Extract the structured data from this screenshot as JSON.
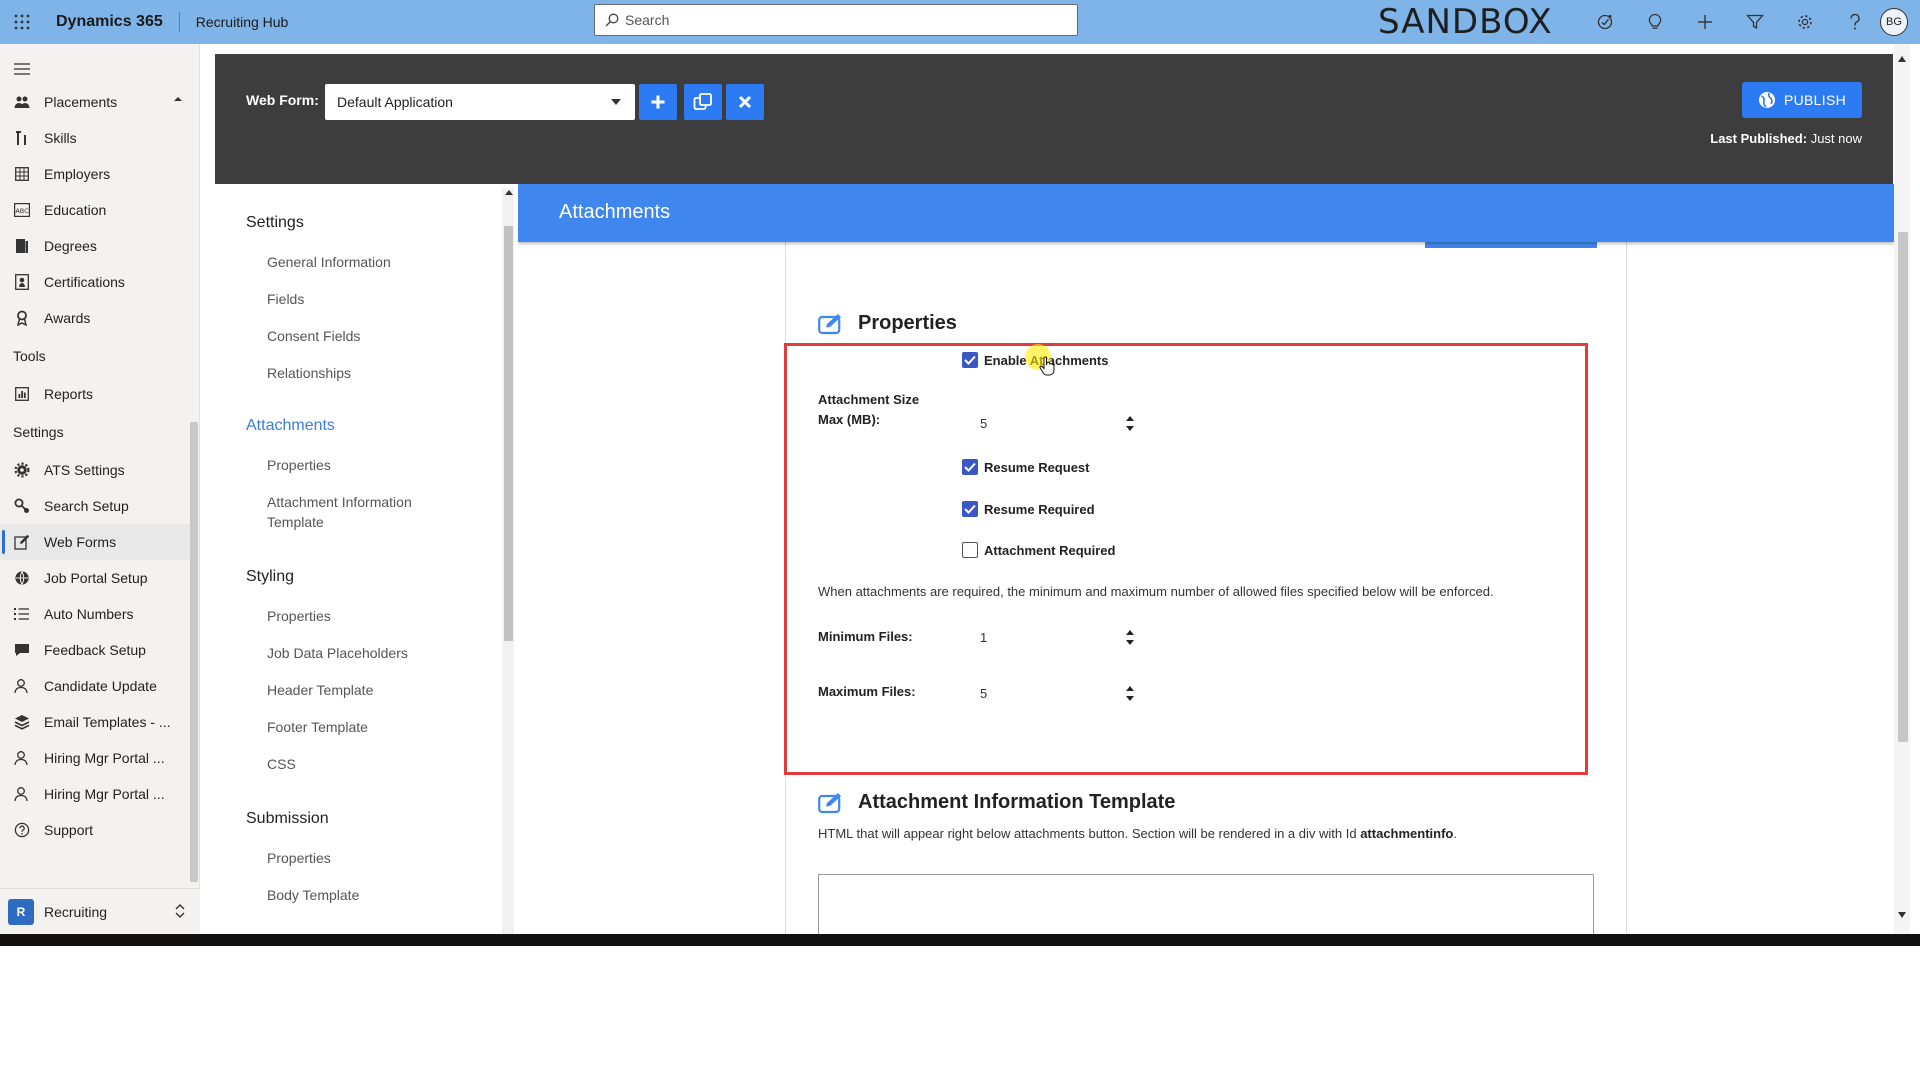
{
  "topbar": {
    "app_name": "Dynamics 365",
    "hub_name": "Recruiting Hub",
    "search_placeholder": "Search",
    "environment_label": "SANDBOX",
    "avatar_initials": "BG",
    "icons": [
      "assistant-icon",
      "lightbulb-icon",
      "plus-icon",
      "filter-icon",
      "gear-icon",
      "help-icon"
    ]
  },
  "leftnav": {
    "items_top": [
      {
        "label": "Placements",
        "icon": "people-icon"
      },
      {
        "label": "Skills",
        "icon": "skills-icon"
      },
      {
        "label": "Employers",
        "icon": "grid-icon"
      },
      {
        "label": "Education",
        "icon": "abc-icon"
      },
      {
        "label": "Degrees",
        "icon": "book-icon"
      },
      {
        "label": "Certifications",
        "icon": "certificate-icon"
      },
      {
        "label": "Awards",
        "icon": "award-icon"
      }
    ],
    "group_tools": "Tools",
    "items_tools": [
      {
        "label": "Reports",
        "icon": "report-icon"
      }
    ],
    "group_settings": "Settings",
    "items_settings": [
      {
        "label": "ATS Settings",
        "icon": "gear-icon"
      },
      {
        "label": "Search Setup",
        "icon": "search-setup-icon"
      },
      {
        "label": "Web Forms",
        "icon": "edit-icon"
      },
      {
        "label": "Job Portal Setup",
        "icon": "globe-icon"
      },
      {
        "label": "Auto Numbers",
        "icon": "list-icon"
      },
      {
        "label": "Feedback Setup",
        "icon": "feedback-icon"
      },
      {
        "label": "Candidate Update",
        "icon": "person-icon"
      },
      {
        "label": "Email Templates - ...",
        "icon": "layers-icon"
      },
      {
        "label": "Hiring Mgr Portal ...",
        "icon": "person-icon"
      },
      {
        "label": "Hiring Mgr Portal ...",
        "icon": "person-icon"
      },
      {
        "label": "Support",
        "icon": "help-icon"
      }
    ],
    "area": {
      "badge": "R",
      "label": "Recruiting"
    }
  },
  "formbar": {
    "label": "Web Form:",
    "selected_form": "Default Application",
    "publish_label": "PUBLISH",
    "last_published_label": "Last Published:",
    "last_published_value": "Just now"
  },
  "tree": {
    "groups": [
      {
        "label": "Settings",
        "items": [
          "General Information",
          "Fields",
          "Consent Fields",
          "Relationships"
        ]
      },
      {
        "label": "Attachments",
        "items": [
          "Properties",
          "Attachment Information Template"
        ]
      },
      {
        "label": "Styling",
        "items": [
          "Properties",
          "Job Data Placeholders",
          "Header Template",
          "Footer Template",
          "CSS"
        ]
      },
      {
        "label": "Submission",
        "items": [
          "Properties",
          "Body Template"
        ]
      }
    ]
  },
  "content": {
    "banner_title": "Attachments",
    "properties_title": "Properties",
    "enable_attachments": {
      "label": "Enable Attachments",
      "checked": true
    },
    "size_label_line1": "Attachment Size",
    "size_label_line2": "Max (MB):",
    "size_value": "5",
    "resume_request": {
      "label": "Resume Request",
      "checked": true
    },
    "resume_required": {
      "label": "Resume Required",
      "checked": true
    },
    "attachment_required": {
      "label": "Attachment Required",
      "checked": false
    },
    "required_note": "When attachments are required, the minimum and maximum number of allowed files specified below will be enforced.",
    "min_files_label": "Minimum Files:",
    "min_files_value": "1",
    "max_files_label": "Maximum Files:",
    "max_files_value": "5",
    "template_title": "Attachment Information Template",
    "template_help_prefix": "HTML that will appear right below attachments button. Section will be rendered in a div with Id",
    "template_help_id": "attachmentinfo",
    "template_help_suffix": "."
  },
  "colors": {
    "topbar": "#7fb4e8",
    "accent": "#2d7bf2",
    "banner": "#3f87ee",
    "highlight_box": "#e23b3b",
    "checkbox": "#3a57c4"
  }
}
